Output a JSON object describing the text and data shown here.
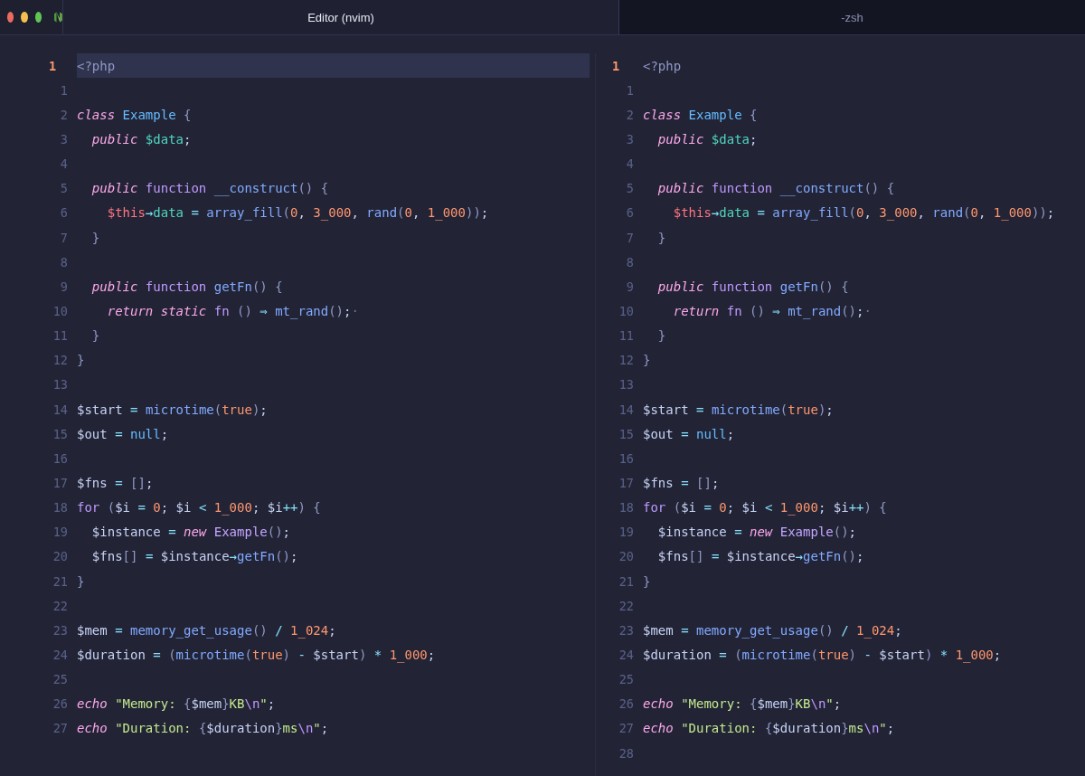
{
  "tabs": [
    {
      "title": "Editor (nvim)",
      "selected": true
    },
    {
      "title": "-zsh",
      "selected": false
    }
  ],
  "panes": [
    {
      "active": true,
      "lines": [
        {
          "num": "1",
          "current": true,
          "tokens": [
            {
              "kind": "tag",
              "text": "<?php"
            }
          ]
        },
        {
          "num": "1",
          "current": false
        },
        {
          "num": "2",
          "current": false,
          "tokens": [
            {
              "kind": "keyword",
              "text": "class "
            },
            {
              "kind": "type",
              "text": "Example "
            },
            {
              "kind": "punct",
              "text": "{"
            }
          ]
        },
        {
          "num": "3",
          "current": false,
          "tokens": [
            {
              "kind": "keyword",
              "text": "  public "
            },
            {
              "kind": "prop",
              "text": "$data"
            },
            {
              "kind": "plain",
              "text": ";"
            }
          ]
        },
        {
          "num": "4",
          "current": false
        },
        {
          "num": "5",
          "current": false,
          "tokens": [
            {
              "kind": "keyword",
              "text": "  public "
            },
            {
              "kind": "storage",
              "text": "function "
            },
            {
              "kind": "call",
              "text": "__construct"
            },
            {
              "kind": "punct",
              "text": "() {"
            }
          ]
        },
        {
          "num": "6",
          "current": false,
          "tokens": [
            {
              "kind": "self",
              "text": "    $this"
            },
            {
              "kind": "op",
              "text": "→"
            },
            {
              "kind": "prop",
              "text": "data "
            },
            {
              "kind": "op",
              "text": "= "
            },
            {
              "kind": "call",
              "text": "array_fill"
            },
            {
              "kind": "punct",
              "text": "("
            },
            {
              "kind": "number",
              "text": "0"
            },
            {
              "kind": "plain",
              "text": ", "
            },
            {
              "kind": "number",
              "text": "3_000"
            },
            {
              "kind": "plain",
              "text": ", "
            },
            {
              "kind": "call",
              "text": "rand"
            },
            {
              "kind": "punct",
              "text": "("
            },
            {
              "kind": "number",
              "text": "0"
            },
            {
              "kind": "plain",
              "text": ", "
            },
            {
              "kind": "number",
              "text": "1_000"
            },
            {
              "kind": "punct",
              "text": "))"
            },
            {
              "kind": "plain",
              "text": ";"
            }
          ]
        },
        {
          "num": "7",
          "current": false,
          "tokens": [
            {
              "kind": "punct",
              "text": "  }"
            }
          ]
        },
        {
          "num": "8",
          "current": false
        },
        {
          "num": "9",
          "current": false,
          "tokens": [
            {
              "kind": "keyword",
              "text": "  public "
            },
            {
              "kind": "storage",
              "text": "function "
            },
            {
              "kind": "call",
              "text": "getFn"
            },
            {
              "kind": "punct",
              "text": "() {"
            }
          ]
        },
        {
          "num": "10",
          "current": false,
          "tokens": [
            {
              "kind": "keyword",
              "text": "    return static "
            },
            {
              "kind": "storage",
              "text": "fn "
            },
            {
              "kind": "punct",
              "text": "() "
            },
            {
              "kind": "op",
              "text": "⇒ "
            },
            {
              "kind": "call",
              "text": "mt_rand"
            },
            {
              "kind": "punct",
              "text": "()"
            },
            {
              "kind": "plain",
              "text": ";"
            },
            {
              "kind": "space",
              "text": "·"
            }
          ]
        },
        {
          "num": "11",
          "current": false,
          "tokens": [
            {
              "kind": "punct",
              "text": "  }"
            }
          ]
        },
        {
          "num": "12",
          "current": false,
          "tokens": [
            {
              "kind": "punct",
              "text": "}"
            }
          ]
        },
        {
          "num": "13",
          "current": false
        },
        {
          "num": "14",
          "current": false,
          "tokens": [
            {
              "kind": "plain",
              "text": "$start "
            },
            {
              "kind": "op",
              "text": "= "
            },
            {
              "kind": "call",
              "text": "microtime"
            },
            {
              "kind": "punct",
              "text": "("
            },
            {
              "kind": "number",
              "text": "true"
            },
            {
              "kind": "punct",
              "text": ")"
            },
            {
              "kind": "plain",
              "text": ";"
            }
          ]
        },
        {
          "num": "15",
          "current": false,
          "tokens": [
            {
              "kind": "plain",
              "text": "$out "
            },
            {
              "kind": "op",
              "text": "= "
            },
            {
              "kind": "const",
              "text": "null"
            },
            {
              "kind": "plain",
              "text": ";"
            }
          ]
        },
        {
          "num": "16",
          "current": false
        },
        {
          "num": "17",
          "current": false,
          "tokens": [
            {
              "kind": "plain",
              "text": "$fns "
            },
            {
              "kind": "op",
              "text": "= "
            },
            {
              "kind": "punct",
              "text": "[]"
            },
            {
              "kind": "plain",
              "text": ";"
            }
          ]
        },
        {
          "num": "18",
          "current": false,
          "tokens": [
            {
              "kind": "storage",
              "text": "for "
            },
            {
              "kind": "punct",
              "text": "("
            },
            {
              "kind": "plain",
              "text": "$i "
            },
            {
              "kind": "op",
              "text": "= "
            },
            {
              "kind": "number",
              "text": "0"
            },
            {
              "kind": "plain",
              "text": "; $i "
            },
            {
              "kind": "op",
              "text": "< "
            },
            {
              "kind": "number",
              "text": "1_000"
            },
            {
              "kind": "plain",
              "text": "; $i"
            },
            {
              "kind": "op",
              "text": "++"
            },
            {
              "kind": "punct",
              "text": ") {"
            }
          ]
        },
        {
          "num": "19",
          "current": false,
          "tokens": [
            {
              "kind": "plain",
              "text": "  $instance "
            },
            {
              "kind": "op",
              "text": "= "
            },
            {
              "kind": "keyword",
              "text": "new "
            },
            {
              "kind": "class",
              "text": "Example"
            },
            {
              "kind": "punct",
              "text": "()"
            },
            {
              "kind": "plain",
              "text": ";"
            }
          ]
        },
        {
          "num": "20",
          "current": false,
          "tokens": [
            {
              "kind": "plain",
              "text": "  $fns"
            },
            {
              "kind": "punct",
              "text": "[] "
            },
            {
              "kind": "op",
              "text": "= "
            },
            {
              "kind": "plain",
              "text": "$instance"
            },
            {
              "kind": "op",
              "text": "→"
            },
            {
              "kind": "call",
              "text": "getFn"
            },
            {
              "kind": "punct",
              "text": "()"
            },
            {
              "kind": "plain",
              "text": ";"
            }
          ]
        },
        {
          "num": "21",
          "current": false,
          "tokens": [
            {
              "kind": "punct",
              "text": "}"
            }
          ]
        },
        {
          "num": "22",
          "current": false
        },
        {
          "num": "23",
          "current": false,
          "tokens": [
            {
              "kind": "plain",
              "text": "$mem "
            },
            {
              "kind": "op",
              "text": "= "
            },
            {
              "kind": "call",
              "text": "memory_get_usage"
            },
            {
              "kind": "punct",
              "text": "() "
            },
            {
              "kind": "op",
              "text": "/ "
            },
            {
              "kind": "number",
              "text": "1_024"
            },
            {
              "kind": "plain",
              "text": ";"
            }
          ]
        },
        {
          "num": "24",
          "current": false,
          "tokens": [
            {
              "kind": "plain",
              "text": "$duration "
            },
            {
              "kind": "op",
              "text": "= "
            },
            {
              "kind": "punct",
              "text": "("
            },
            {
              "kind": "call",
              "text": "microtime"
            },
            {
              "kind": "punct",
              "text": "("
            },
            {
              "kind": "number",
              "text": "true"
            },
            {
              "kind": "punct",
              "text": ") "
            },
            {
              "kind": "op",
              "text": "- "
            },
            {
              "kind": "plain",
              "text": "$start"
            },
            {
              "kind": "punct",
              "text": ") "
            },
            {
              "kind": "op",
              "text": "* "
            },
            {
              "kind": "number",
              "text": "1_000"
            },
            {
              "kind": "plain",
              "text": ";"
            }
          ]
        },
        {
          "num": "25",
          "current": false
        },
        {
          "num": "26",
          "current": false,
          "tokens": [
            {
              "kind": "keyword",
              "text": "echo "
            },
            {
              "kind": "string",
              "text": "\"Memory: "
            },
            {
              "kind": "punct",
              "text": "{"
            },
            {
              "kind": "plain",
              "text": "$mem"
            },
            {
              "kind": "punct",
              "text": "}"
            },
            {
              "kind": "string",
              "text": "KB"
            },
            {
              "kind": "escape",
              "text": "\\n"
            },
            {
              "kind": "string",
              "text": "\""
            },
            {
              "kind": "plain",
              "text": ";"
            }
          ]
        },
        {
          "num": "27",
          "current": false,
          "tokens": [
            {
              "kind": "keyword",
              "text": "echo "
            },
            {
              "kind": "string",
              "text": "\"Duration: "
            },
            {
              "kind": "punct",
              "text": "{"
            },
            {
              "kind": "plain",
              "text": "$duration"
            },
            {
              "kind": "punct",
              "text": "}"
            },
            {
              "kind": "string",
              "text": "ms"
            },
            {
              "kind": "escape",
              "text": "\\n"
            },
            {
              "kind": "string",
              "text": "\""
            },
            {
              "kind": "plain",
              "text": ";"
            }
          ]
        }
      ]
    },
    {
      "active": false,
      "lines": [
        {
          "num": "1",
          "current": true,
          "tokens": [
            {
              "kind": "tag",
              "text": "<?php"
            }
          ]
        },
        {
          "num": "1",
          "current": false
        },
        {
          "num": "2",
          "current": false,
          "tokens": [
            {
              "kind": "keyword",
              "text": "class "
            },
            {
              "kind": "type",
              "text": "Example "
            },
            {
              "kind": "punct",
              "text": "{"
            }
          ]
        },
        {
          "num": "3",
          "current": false,
          "tokens": [
            {
              "kind": "keyword",
              "text": "  public "
            },
            {
              "kind": "prop",
              "text": "$data"
            },
            {
              "kind": "plain",
              "text": ";"
            }
          ]
        },
        {
          "num": "4",
          "current": false
        },
        {
          "num": "5",
          "current": false,
          "tokens": [
            {
              "kind": "keyword",
              "text": "  public "
            },
            {
              "kind": "storage",
              "text": "function "
            },
            {
              "kind": "call",
              "text": "__construct"
            },
            {
              "kind": "punct",
              "text": "() {"
            }
          ]
        },
        {
          "num": "6",
          "current": false,
          "tokens": [
            {
              "kind": "self",
              "text": "    $this"
            },
            {
              "kind": "op",
              "text": "→"
            },
            {
              "kind": "prop",
              "text": "data "
            },
            {
              "kind": "op",
              "text": "= "
            },
            {
              "kind": "call",
              "text": "array_fill"
            },
            {
              "kind": "punct",
              "text": "("
            },
            {
              "kind": "number",
              "text": "0"
            },
            {
              "kind": "plain",
              "text": ", "
            },
            {
              "kind": "number",
              "text": "3_000"
            },
            {
              "kind": "plain",
              "text": ", "
            },
            {
              "kind": "call",
              "text": "rand"
            },
            {
              "kind": "punct",
              "text": "("
            },
            {
              "kind": "number",
              "text": "0"
            },
            {
              "kind": "plain",
              "text": ", "
            },
            {
              "kind": "number",
              "text": "1_000"
            },
            {
              "kind": "punct",
              "text": "))"
            },
            {
              "kind": "plain",
              "text": ";"
            }
          ]
        },
        {
          "num": "7",
          "current": false,
          "tokens": [
            {
              "kind": "punct",
              "text": "  }"
            }
          ]
        },
        {
          "num": "8",
          "current": false
        },
        {
          "num": "9",
          "current": false,
          "tokens": [
            {
              "kind": "keyword",
              "text": "  public "
            },
            {
              "kind": "storage",
              "text": "function "
            },
            {
              "kind": "call",
              "text": "getFn"
            },
            {
              "kind": "punct",
              "text": "() {"
            }
          ]
        },
        {
          "num": "10",
          "current": false,
          "tokens": [
            {
              "kind": "keyword",
              "text": "    return "
            },
            {
              "kind": "storage",
              "text": "fn "
            },
            {
              "kind": "punct",
              "text": "() "
            },
            {
              "kind": "op",
              "text": "⇒ "
            },
            {
              "kind": "call",
              "text": "mt_rand"
            },
            {
              "kind": "punct",
              "text": "()"
            },
            {
              "kind": "plain",
              "text": ";"
            },
            {
              "kind": "space",
              "text": "·"
            }
          ]
        },
        {
          "num": "11",
          "current": false,
          "tokens": [
            {
              "kind": "punct",
              "text": "  }"
            }
          ]
        },
        {
          "num": "12",
          "current": false,
          "tokens": [
            {
              "kind": "punct",
              "text": "}"
            }
          ]
        },
        {
          "num": "13",
          "current": false
        },
        {
          "num": "14",
          "current": false,
          "tokens": [
            {
              "kind": "plain",
              "text": "$start "
            },
            {
              "kind": "op",
              "text": "= "
            },
            {
              "kind": "call",
              "text": "microtime"
            },
            {
              "kind": "punct",
              "text": "("
            },
            {
              "kind": "number",
              "text": "true"
            },
            {
              "kind": "punct",
              "text": ")"
            },
            {
              "kind": "plain",
              "text": ";"
            }
          ]
        },
        {
          "num": "15",
          "current": false,
          "tokens": [
            {
              "kind": "plain",
              "text": "$out "
            },
            {
              "kind": "op",
              "text": "= "
            },
            {
              "kind": "const",
              "text": "null"
            },
            {
              "kind": "plain",
              "text": ";"
            }
          ]
        },
        {
          "num": "16",
          "current": false
        },
        {
          "num": "17",
          "current": false,
          "tokens": [
            {
              "kind": "plain",
              "text": "$fns "
            },
            {
              "kind": "op",
              "text": "= "
            },
            {
              "kind": "punct",
              "text": "[]"
            },
            {
              "kind": "plain",
              "text": ";"
            }
          ]
        },
        {
          "num": "18",
          "current": false,
          "tokens": [
            {
              "kind": "storage",
              "text": "for "
            },
            {
              "kind": "punct",
              "text": "("
            },
            {
              "kind": "plain",
              "text": "$i "
            },
            {
              "kind": "op",
              "text": "= "
            },
            {
              "kind": "number",
              "text": "0"
            },
            {
              "kind": "plain",
              "text": "; $i "
            },
            {
              "kind": "op",
              "text": "< "
            },
            {
              "kind": "number",
              "text": "1_000"
            },
            {
              "kind": "plain",
              "text": "; $i"
            },
            {
              "kind": "op",
              "text": "++"
            },
            {
              "kind": "punct",
              "text": ") {"
            }
          ]
        },
        {
          "num": "19",
          "current": false,
          "tokens": [
            {
              "kind": "plain",
              "text": "  $instance "
            },
            {
              "kind": "op",
              "text": "= "
            },
            {
              "kind": "keyword",
              "text": "new "
            },
            {
              "kind": "class",
              "text": "Example"
            },
            {
              "kind": "punct",
              "text": "()"
            },
            {
              "kind": "plain",
              "text": ";"
            }
          ]
        },
        {
          "num": "20",
          "current": false,
          "tokens": [
            {
              "kind": "plain",
              "text": "  $fns"
            },
            {
              "kind": "punct",
              "text": "[] "
            },
            {
              "kind": "op",
              "text": "= "
            },
            {
              "kind": "plain",
              "text": "$instance"
            },
            {
              "kind": "op",
              "text": "→"
            },
            {
              "kind": "call",
              "text": "getFn"
            },
            {
              "kind": "punct",
              "text": "()"
            },
            {
              "kind": "plain",
              "text": ";"
            }
          ]
        },
        {
          "num": "21",
          "current": false,
          "tokens": [
            {
              "kind": "punct",
              "text": "}"
            }
          ]
        },
        {
          "num": "22",
          "current": false
        },
        {
          "num": "23",
          "current": false,
          "tokens": [
            {
              "kind": "plain",
              "text": "$mem "
            },
            {
              "kind": "op",
              "text": "= "
            },
            {
              "kind": "call",
              "text": "memory_get_usage"
            },
            {
              "kind": "punct",
              "text": "() "
            },
            {
              "kind": "op",
              "text": "/ "
            },
            {
              "kind": "number",
              "text": "1_024"
            },
            {
              "kind": "plain",
              "text": ";"
            }
          ]
        },
        {
          "num": "24",
          "current": false,
          "tokens": [
            {
              "kind": "plain",
              "text": "$duration "
            },
            {
              "kind": "op",
              "text": "= "
            },
            {
              "kind": "punct",
              "text": "("
            },
            {
              "kind": "call",
              "text": "microtime"
            },
            {
              "kind": "punct",
              "text": "("
            },
            {
              "kind": "number",
              "text": "true"
            },
            {
              "kind": "punct",
              "text": ") "
            },
            {
              "kind": "op",
              "text": "- "
            },
            {
              "kind": "plain",
              "text": "$start"
            },
            {
              "kind": "punct",
              "text": ") "
            },
            {
              "kind": "op",
              "text": "* "
            },
            {
              "kind": "number",
              "text": "1_000"
            },
            {
              "kind": "plain",
              "text": ";"
            }
          ]
        },
        {
          "num": "25",
          "current": false
        },
        {
          "num": "26",
          "current": false,
          "tokens": [
            {
              "kind": "keyword",
              "text": "echo "
            },
            {
              "kind": "string",
              "text": "\"Memory: "
            },
            {
              "kind": "punct",
              "text": "{"
            },
            {
              "kind": "plain",
              "text": "$mem"
            },
            {
              "kind": "punct",
              "text": "}"
            },
            {
              "kind": "string",
              "text": "KB"
            },
            {
              "kind": "escape",
              "text": "\\n"
            },
            {
              "kind": "string",
              "text": "\""
            },
            {
              "kind": "plain",
              "text": ";"
            }
          ]
        },
        {
          "num": "27",
          "current": false,
          "tokens": [
            {
              "kind": "keyword",
              "text": "echo "
            },
            {
              "kind": "string",
              "text": "\"Duration: "
            },
            {
              "kind": "punct",
              "text": "{"
            },
            {
              "kind": "plain",
              "text": "$duration"
            },
            {
              "kind": "punct",
              "text": "}"
            },
            {
              "kind": "string",
              "text": "ms"
            },
            {
              "kind": "escape",
              "text": "\\n"
            },
            {
              "kind": "string",
              "text": "\""
            },
            {
              "kind": "plain",
              "text": ";"
            }
          ]
        },
        {
          "num": "28",
          "current": false
        }
      ]
    }
  ]
}
